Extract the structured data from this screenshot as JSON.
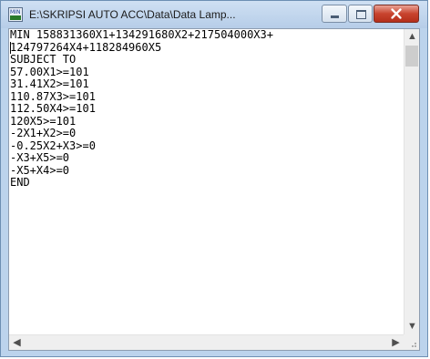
{
  "window": {
    "title": "E:\\SKRIPSI AUTO ACC\\Data\\Data Lamp...",
    "icon": "lindo-app-icon",
    "controls": {
      "minimize": "minimize-icon",
      "maximize": "maximize-icon",
      "close": "close-icon"
    },
    "accent_close": "#c8432e"
  },
  "editor": {
    "lines": [
      "MIN 158831360X1+134291680X2+217504000X3+",
      "124797264X4+118284960X5",
      "SUBJECT TO",
      "57.00X1>=101",
      "31.41X2>=101",
      "110.87X3>=101",
      "112.50X4>=101",
      "120X5>=101",
      "-2X1+X2>=0",
      "-0.25X2+X3>=0",
      "-X3+X5>=0",
      "-X5+X4>=0",
      "END"
    ]
  },
  "scrollbars": {
    "up": "▲",
    "down": "▼",
    "left": "◀",
    "right": "▶"
  }
}
